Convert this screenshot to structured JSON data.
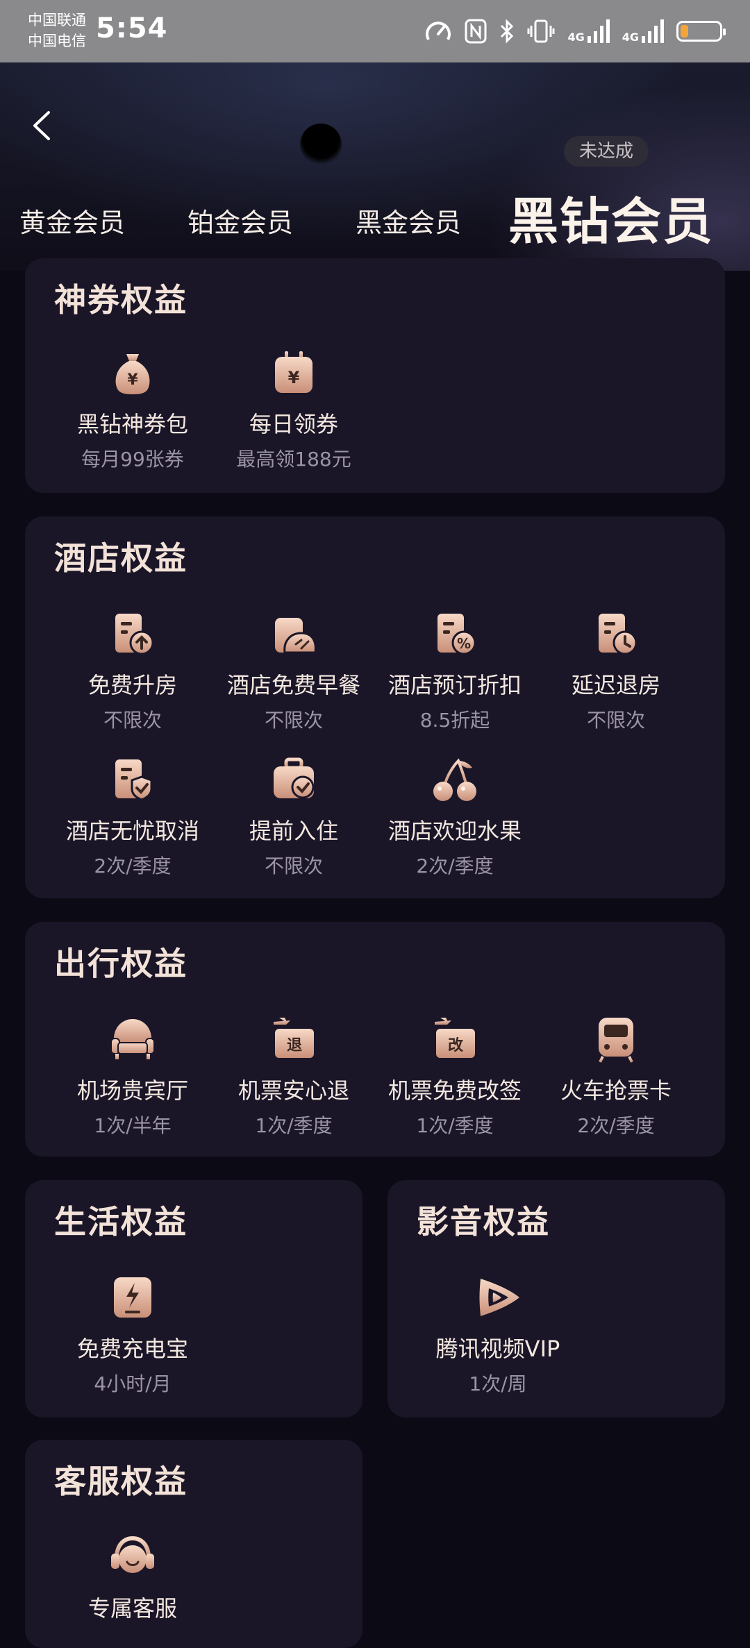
{
  "status_bar": {
    "carrier1": "中国联通",
    "carrier2": "中国电信",
    "time": "5:54",
    "net1": "4G",
    "net2": "4G",
    "battery_level": 0.2,
    "battery_color": "#f3a53a"
  },
  "header": {
    "badge": "未达成",
    "tabs": [
      {
        "label": "黄金会员"
      },
      {
        "label": "铂金会员"
      },
      {
        "label": "黑金会员"
      },
      {
        "label": "黑钻会员"
      }
    ]
  },
  "sections": {
    "coupon": {
      "title": "神券权益",
      "items": [
        {
          "name": "黑钻神券包",
          "sub": "每月99张券",
          "icon": "money-bag-icon"
        },
        {
          "name": "每日领券",
          "sub": "最高领188元",
          "icon": "calendar-yen-icon"
        }
      ]
    },
    "hotel": {
      "title": "酒店权益",
      "items": [
        {
          "name": "免费升房",
          "sub": "不限次",
          "icon": "room-upgrade-icon"
        },
        {
          "name": "酒店免费早餐",
          "sub": "不限次",
          "icon": "breakfast-icon"
        },
        {
          "name": "酒店预订折扣",
          "sub": "8.5折起",
          "icon": "discount-icon"
        },
        {
          "name": "延迟退房",
          "sub": "不限次",
          "icon": "late-checkout-icon"
        },
        {
          "name": "酒店无忧取消",
          "sub": "2次/季度",
          "icon": "free-cancel-icon"
        },
        {
          "name": "提前入住",
          "sub": "不限次",
          "icon": "early-checkin-icon"
        },
        {
          "name": "酒店欢迎水果",
          "sub": "2次/季度",
          "icon": "cherry-icon"
        }
      ]
    },
    "travel": {
      "title": "出行权益",
      "items": [
        {
          "name": "机场贵宾厅",
          "sub": "1次/半年",
          "icon": "vip-lounge-icon",
          "glyph": ""
        },
        {
          "name": "机票安心退",
          "sub": "1次/季度",
          "icon": "ticket-refund-icon",
          "glyph": "退"
        },
        {
          "name": "机票免费改签",
          "sub": "1次/季度",
          "icon": "ticket-change-icon",
          "glyph": "改"
        },
        {
          "name": "火车抢票卡",
          "sub": "2次/季度",
          "icon": "train-icon",
          "glyph": ""
        }
      ]
    },
    "life": {
      "title": "生活权益",
      "items": [
        {
          "name": "免费充电宝",
          "sub": "4小时/月",
          "icon": "power-bank-icon"
        }
      ]
    },
    "media": {
      "title": "影音权益",
      "items": [
        {
          "name": "腾讯视频VIP",
          "sub": "1次/周",
          "icon": "tencent-video-icon"
        }
      ]
    },
    "service": {
      "title": "客服权益",
      "items": [
        {
          "name": "专属客服",
          "sub": "",
          "icon": "headset-icon"
        }
      ]
    }
  },
  "colors": {
    "background": "#0c0a14",
    "card": "#1a1628",
    "accent_gold": "#e8b7a0",
    "title_text": "#f3e2d8",
    "sub_text": "#9c94a6"
  }
}
